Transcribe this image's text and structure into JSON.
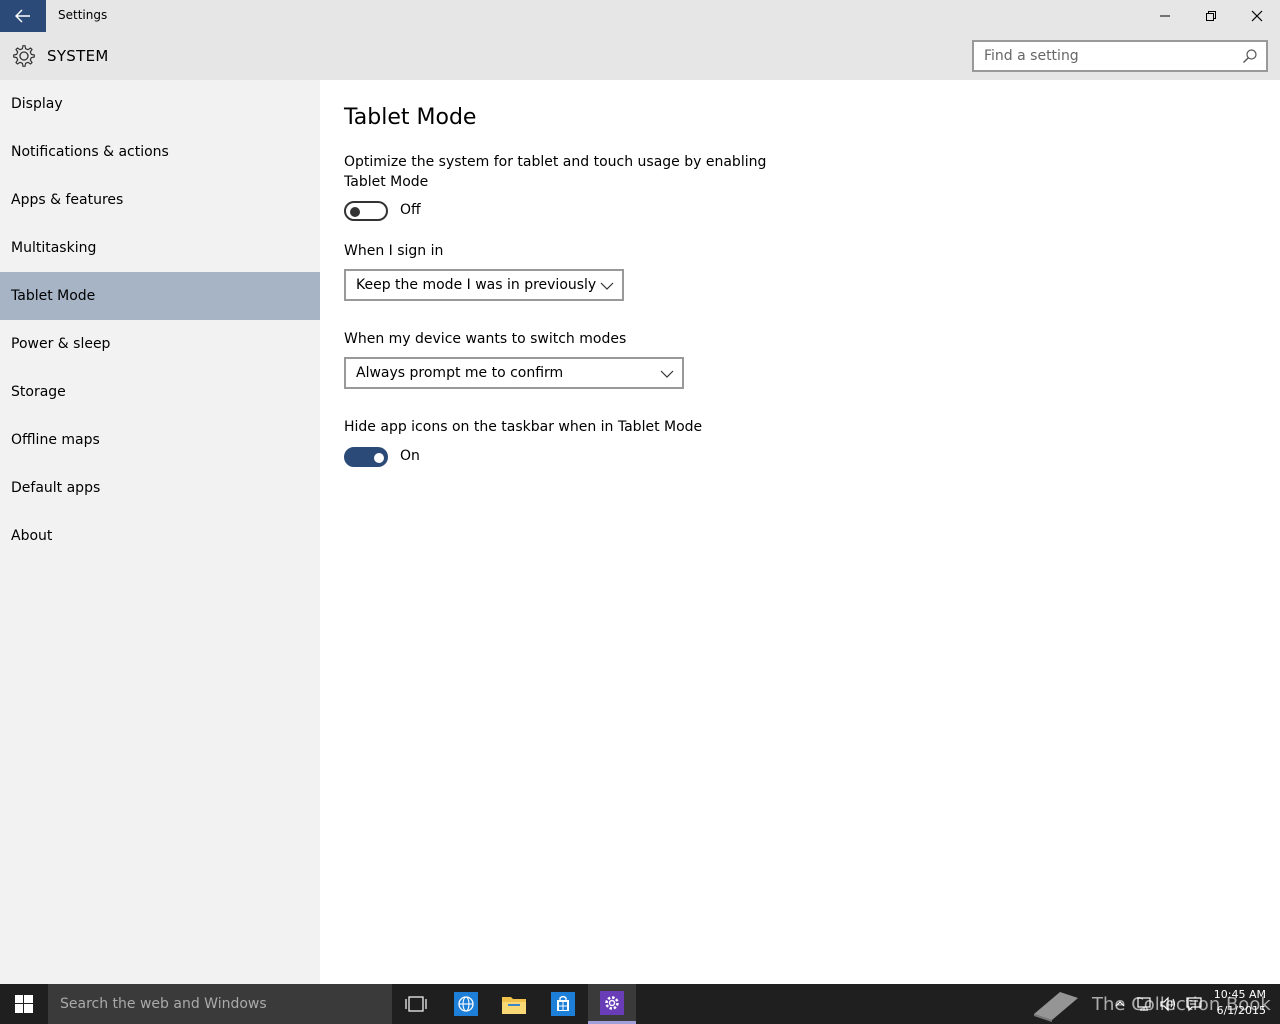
{
  "window": {
    "title": "Settings"
  },
  "header": {
    "section": "SYSTEM",
    "search_placeholder": "Find a setting"
  },
  "sidebar": {
    "items": [
      {
        "label": "Display"
      },
      {
        "label": "Notifications & actions"
      },
      {
        "label": "Apps & features"
      },
      {
        "label": "Multitasking"
      },
      {
        "label": "Tablet Mode",
        "active": true
      },
      {
        "label": "Power & sleep"
      },
      {
        "label": "Storage"
      },
      {
        "label": "Offline maps"
      },
      {
        "label": "Default apps"
      },
      {
        "label": "About"
      }
    ]
  },
  "main": {
    "title": "Tablet Mode",
    "tablet_mode": {
      "description": "Optimize the system for tablet and touch usage by enabling Tablet Mode",
      "state": "Off"
    },
    "sign_in": {
      "label": "When I sign in",
      "selected": "Keep the mode I was in previously"
    },
    "switch_modes": {
      "label": "When my device wants to switch modes",
      "selected": "Always prompt me to confirm"
    },
    "hide_icons": {
      "label": "Hide app icons on the taskbar when in Tablet Mode",
      "state": "On"
    }
  },
  "taskbar": {
    "search_text": "Search the web and Windows",
    "watermark": "The Collection Book",
    "time": "10:45 AM",
    "date": "6/1/2015"
  },
  "colors": {
    "accent": "#2b4a78",
    "sidebar_active": "#a6b4c6",
    "sidebar_bg": "#f2f2f2",
    "titlebar_bg": "#e6e6e6",
    "taskbar_bg": "#1f1f1f"
  }
}
